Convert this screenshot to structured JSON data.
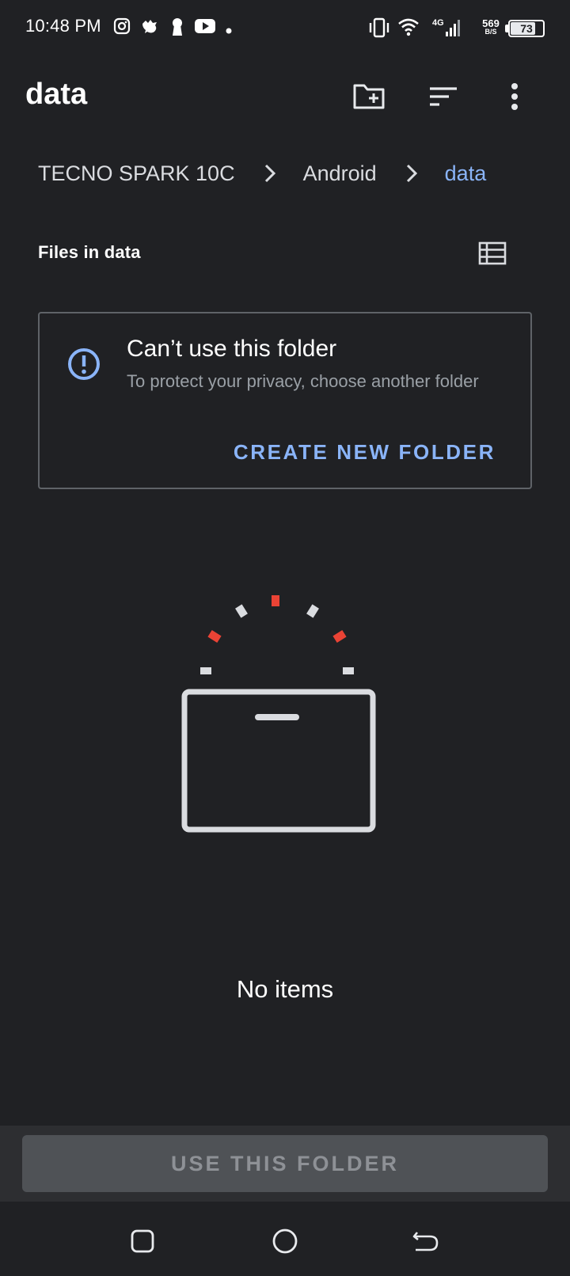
{
  "status_bar": {
    "time": "10:48 PM",
    "notification_icons": [
      "instagram-icon",
      "bird-icon",
      "keyhole-icon",
      "youtube-icon",
      "dot-icon"
    ],
    "system_icons": [
      "vibrate-icon",
      "wifi-icon",
      "signal-4g-icon"
    ],
    "network_type": "4G",
    "net_speed_value": "569",
    "net_speed_unit": "B/S",
    "battery_level": "73",
    "battery_fraction": 0.73
  },
  "app_bar": {
    "title": "data",
    "actions": [
      "new-folder-icon",
      "sort-icon",
      "more-vert-icon"
    ]
  },
  "breadcrumb": {
    "items": [
      "TECNO SPARK 10C",
      "Android",
      "data"
    ]
  },
  "section": {
    "title": "Files in data",
    "view_toggle_icon": "list-view-icon"
  },
  "warning_card": {
    "icon": "alert-circle-icon",
    "title": "Can’t use this folder",
    "description": "To protect your privacy, choose another folder",
    "action_label": "CREATE NEW FOLDER"
  },
  "empty_state": {
    "illustration": "empty-box-icon",
    "text": "No items"
  },
  "bottom_action": {
    "label": "USE THIS FOLDER",
    "enabled": false
  },
  "nav_bar": {
    "buttons": [
      "recents-icon",
      "home-icon",
      "back-icon"
    ]
  },
  "colors": {
    "background": "#202124",
    "accent": "#8ab4f8",
    "illustration_red": "#ea4335",
    "illustration_gray": "#dadce0"
  }
}
